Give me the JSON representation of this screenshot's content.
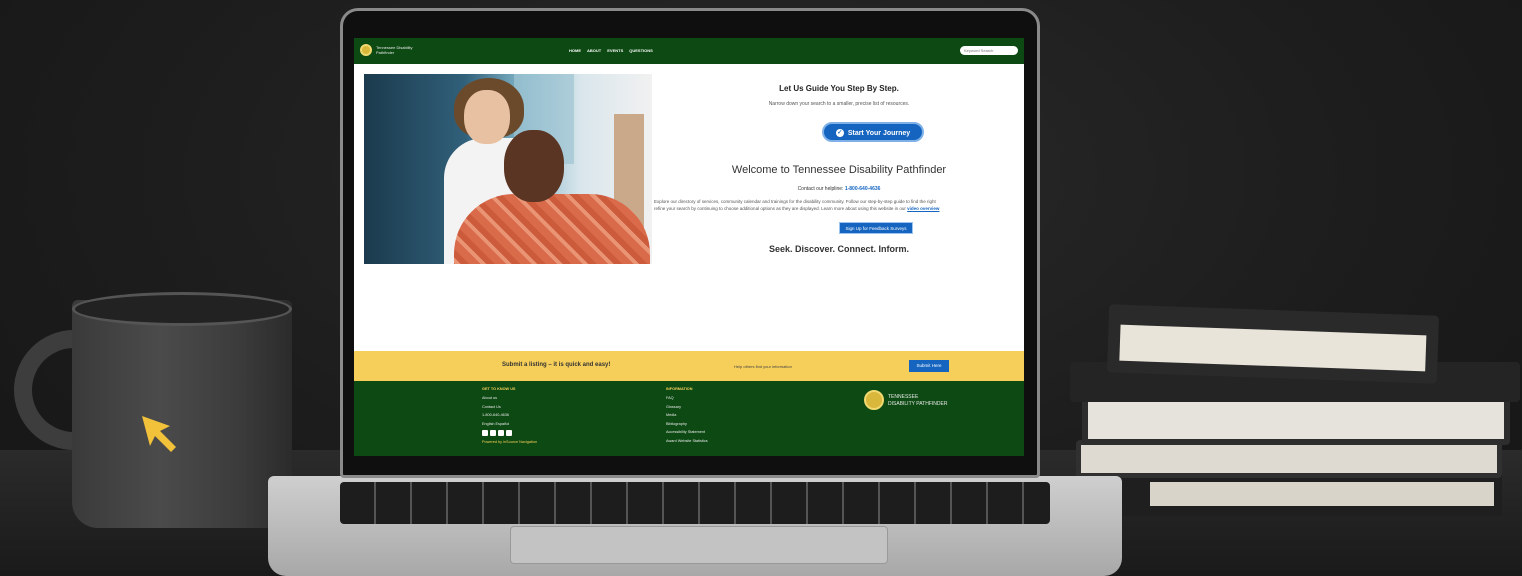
{
  "site": {
    "logo_text": "Tennessee Disability Pathfinder",
    "nav": [
      "HOME",
      "ABOUT",
      "EVENTS",
      "QUESTIONS"
    ],
    "search_placeholder": "Keyword Search"
  },
  "main": {
    "guide_heading": "Let Us Guide You Step By Step.",
    "guide_sub": "Narrow down your search to a smaller, precise list of resources.",
    "start_button": "Start Your Journey",
    "welcome_heading": "Welcome to Tennessee Disability Pathfinder",
    "helpline_label": "Contact our helpline:",
    "helpline_number": "1-800-640-4636",
    "para_line1": "Explore our directory of services, community calendar and trainings for the disability community. Follow our step-by-step guide to find the right",
    "para_line2": "refine your search by continuing to choose additional options as they are displayed. Learn more about using this website in our",
    "para_link": "video overview",
    "feedback_button": "Sign Up for Feedback Surveys",
    "tagline": "Seek. Discover. Connect. Inform."
  },
  "band": {
    "cta": "Submit a listing – it is quick and easy!",
    "help_text": "Help others find your information",
    "submit_button": "Submit Here"
  },
  "footer": {
    "col1_heading": "GET TO KNOW US",
    "col1_items": [
      "About us",
      "Contact Us",
      "1-800-640-4636",
      "English     Español"
    ],
    "powered_by": "Powered by inSource Navigation",
    "col2_heading": "INFORMATION",
    "col2_items": [
      "FAQ",
      "Glossary",
      "Media",
      "Bibliography",
      "Accessibility Statement",
      "Award Website Statistics"
    ],
    "logo_line1": "TENNESSEE",
    "logo_line2": "DISABILITY PATHFINDER"
  },
  "colors": {
    "brand_green": "#0d4a13",
    "accent_blue": "#1565c0",
    "band_yellow": "#f6cf5a",
    "cursor_yellow": "#f2c23a"
  }
}
